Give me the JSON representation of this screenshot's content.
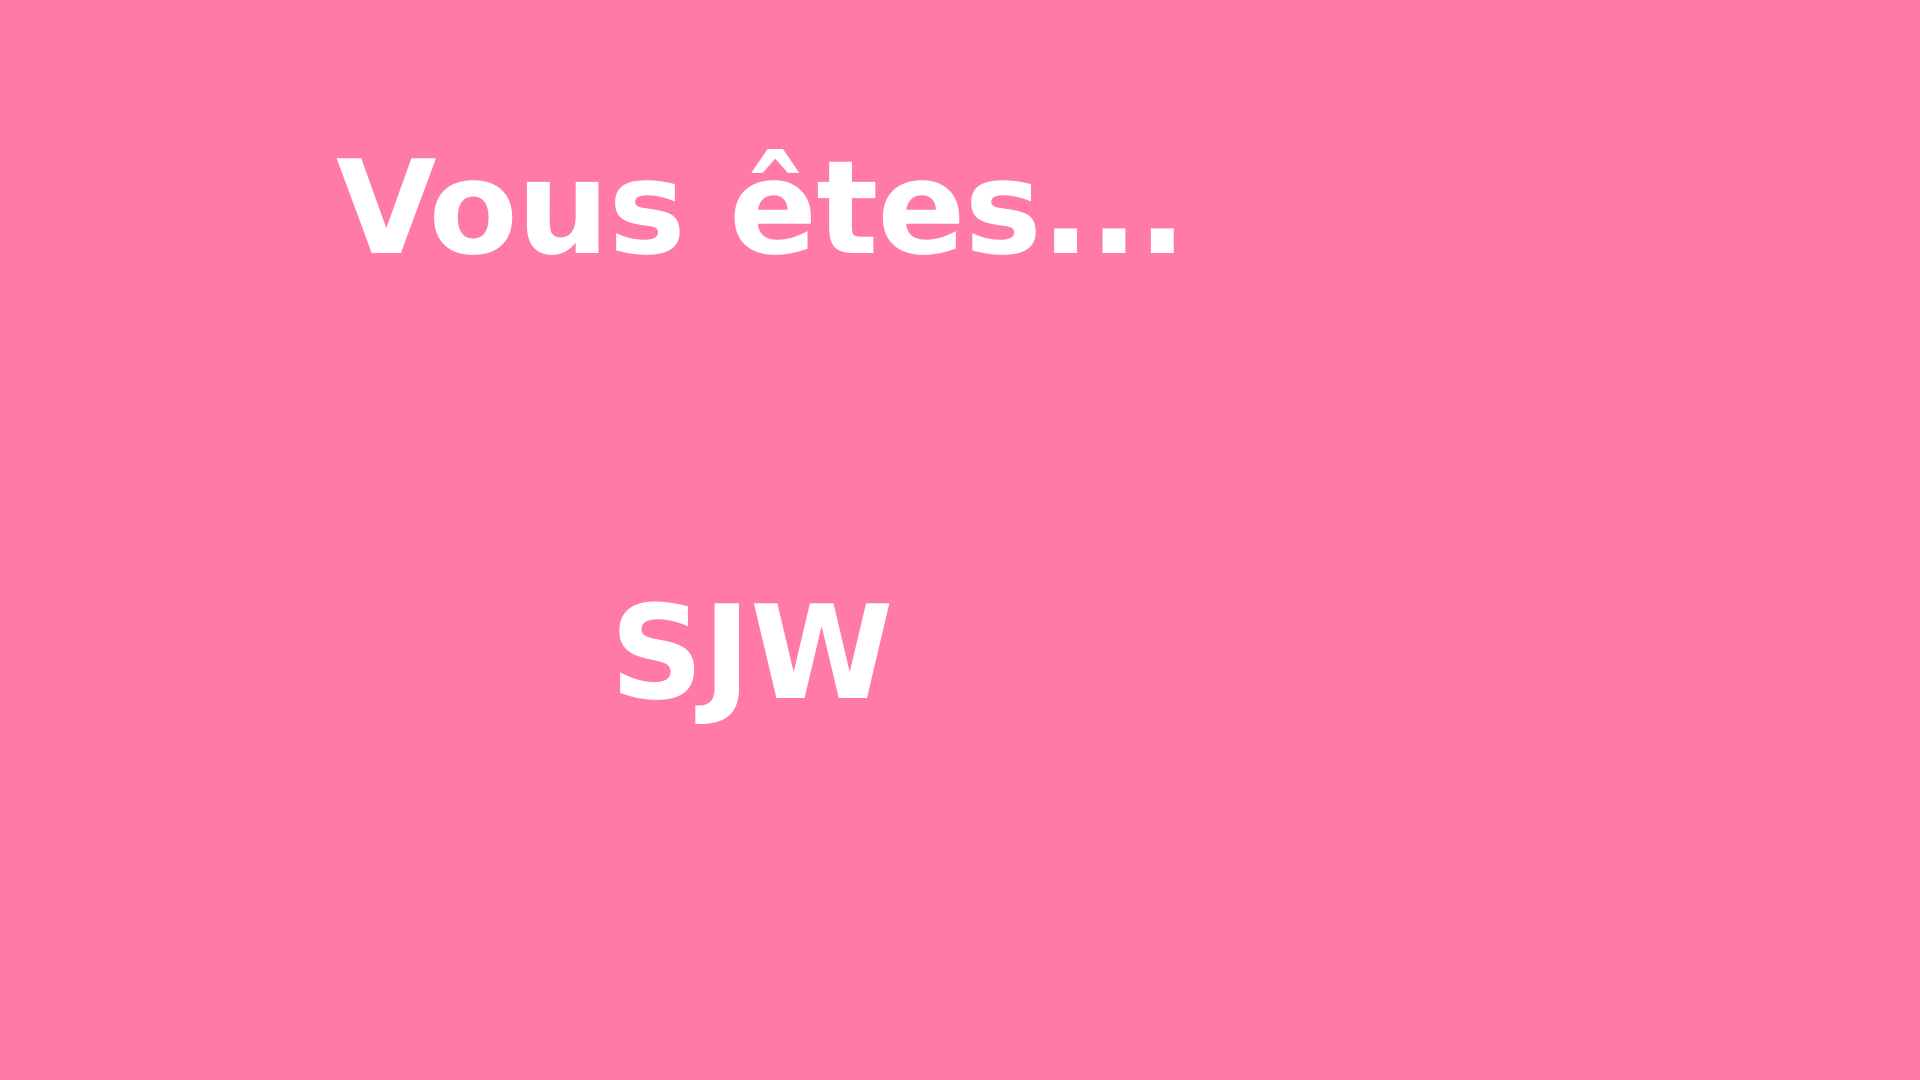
{
  "slide": {
    "background_color": "#ff7ba6",
    "text_color": "#ffffff",
    "heading": "Vous êtes...",
    "answer": "SJW"
  }
}
